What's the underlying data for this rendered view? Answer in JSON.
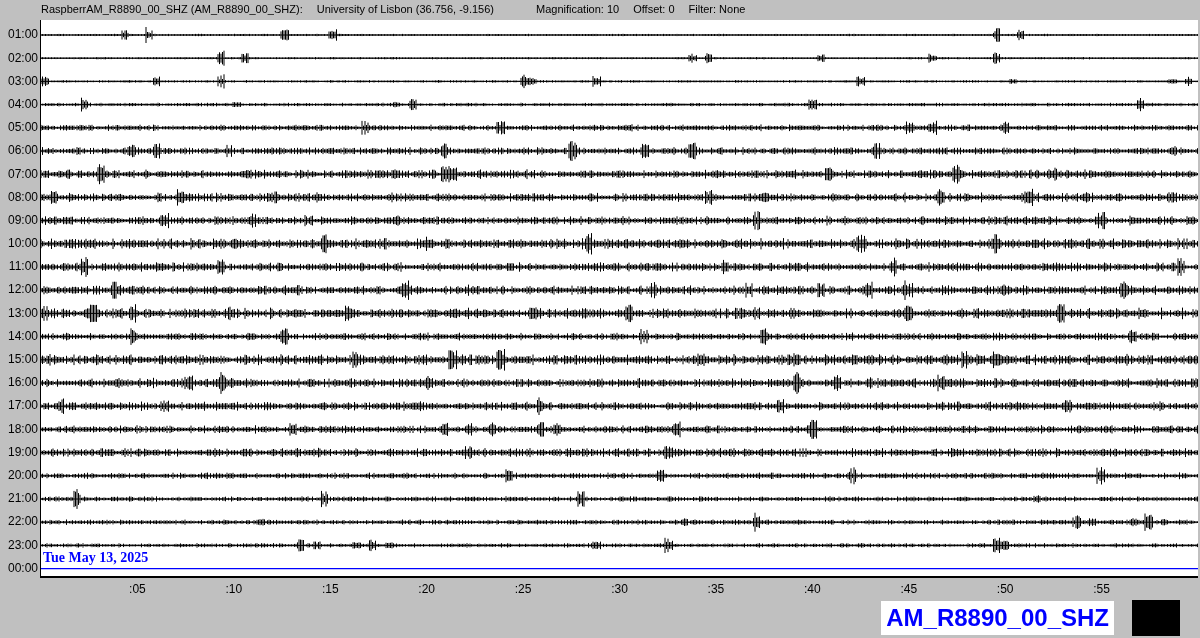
{
  "header": {
    "station": "RaspberrAM_R8890_00_SHZ (AM_R8890_00_SHZ):",
    "location": "University of Lisbon (36.756, -9.156)",
    "magnification": "Magnification: 10",
    "offset": "Offset: 0",
    "filter": "Filter: None"
  },
  "hour_labels": [
    "01:00",
    "02:00",
    "03:00",
    "04:00",
    "05:00",
    "06:00",
    "07:00",
    "08:00",
    "09:00",
    "10:00",
    "11:00",
    "12:00",
    "13:00",
    "14:00",
    "15:00",
    "16:00",
    "17:00",
    "18:00",
    "19:00",
    "20:00",
    "21:00",
    "22:00",
    "23:00",
    "00:00"
  ],
  "date_label": "Tue May 13, 2025",
  "minute_ticks": [
    ":05",
    ":10",
    ":15",
    ":20",
    ":25",
    ":30",
    ":35",
    ":40",
    ":45",
    ":50",
    ":55"
  ],
  "legend_label": "AM_R8890_00_SHZ"
}
